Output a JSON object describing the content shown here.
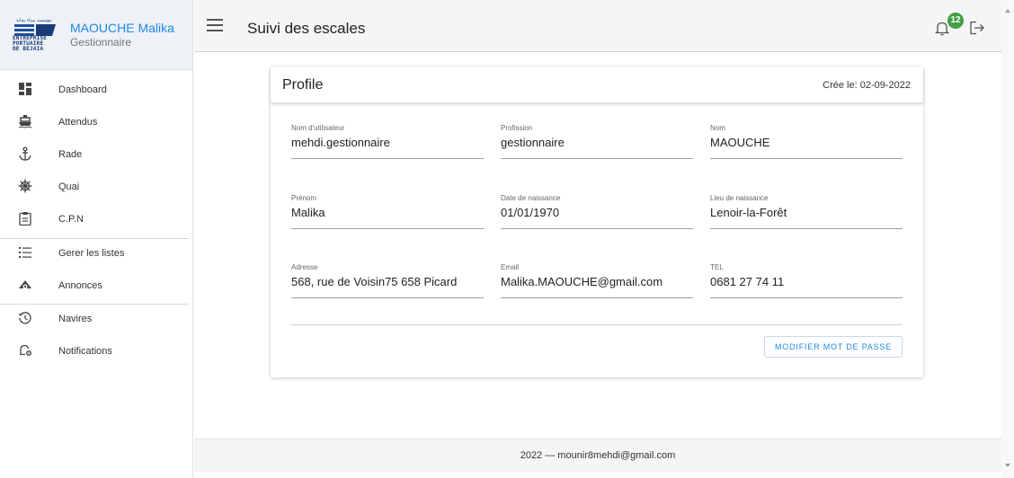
{
  "user": {
    "logo_text_lines": [
      "ENTREPRISE",
      "PORTUAIRE",
      "DE BEJAIA"
    ],
    "logo_arabic": "مؤسسة ميناء بجاية",
    "name": "MAOUCHE Malika",
    "role": "Gestionnaire"
  },
  "nav": [
    {
      "label": "Dashboard",
      "icon": "dashboard-icon"
    },
    {
      "label": "Attendus",
      "icon": "ship-icon"
    },
    {
      "label": "Rade",
      "icon": "anchor-icon"
    },
    {
      "label": "Quai",
      "icon": "helm-icon"
    },
    {
      "label": "C.P.N",
      "icon": "clipboard-icon"
    },
    {
      "label": "Gerer les listes",
      "icon": "list-icon"
    },
    {
      "label": "Annonces",
      "icon": "announcement-icon"
    },
    {
      "label": "Navires",
      "icon": "history-icon"
    },
    {
      "label": "Notifications",
      "icon": "bell-settings-icon"
    }
  ],
  "topbar": {
    "title": "Suivi des escales",
    "notification_count": "12"
  },
  "profile": {
    "title": "Profile",
    "created": "Crée le: 02-09-2022",
    "fields": [
      {
        "label": "Nom d'utilisateur",
        "value": "mehdi.gestionnaire"
      },
      {
        "label": "Profission",
        "value": "gestionnaire"
      },
      {
        "label": "Nom",
        "value": "MAOUCHE"
      },
      {
        "label": "Prénom",
        "value": "Malika"
      },
      {
        "label": "Date de naissance",
        "value": "01/01/1970"
      },
      {
        "label": "Lieu de naissance",
        "value": "Lenoir-la-Forêt"
      },
      {
        "label": "Adresse",
        "value": "568, rue de Voisin75 658 Picard"
      },
      {
        "label": "Email",
        "value": "Malika.MAOUCHE@gmail.com"
      },
      {
        "label": "TEL",
        "value": "0681 27 74 11"
      }
    ],
    "button": "MODIFIER MOT DE PASSE"
  },
  "footer": {
    "text": "2022 — mounir8mehdi@gmail.com"
  },
  "colors": {
    "accent": "#1e88e5",
    "badge": "#43a047"
  }
}
